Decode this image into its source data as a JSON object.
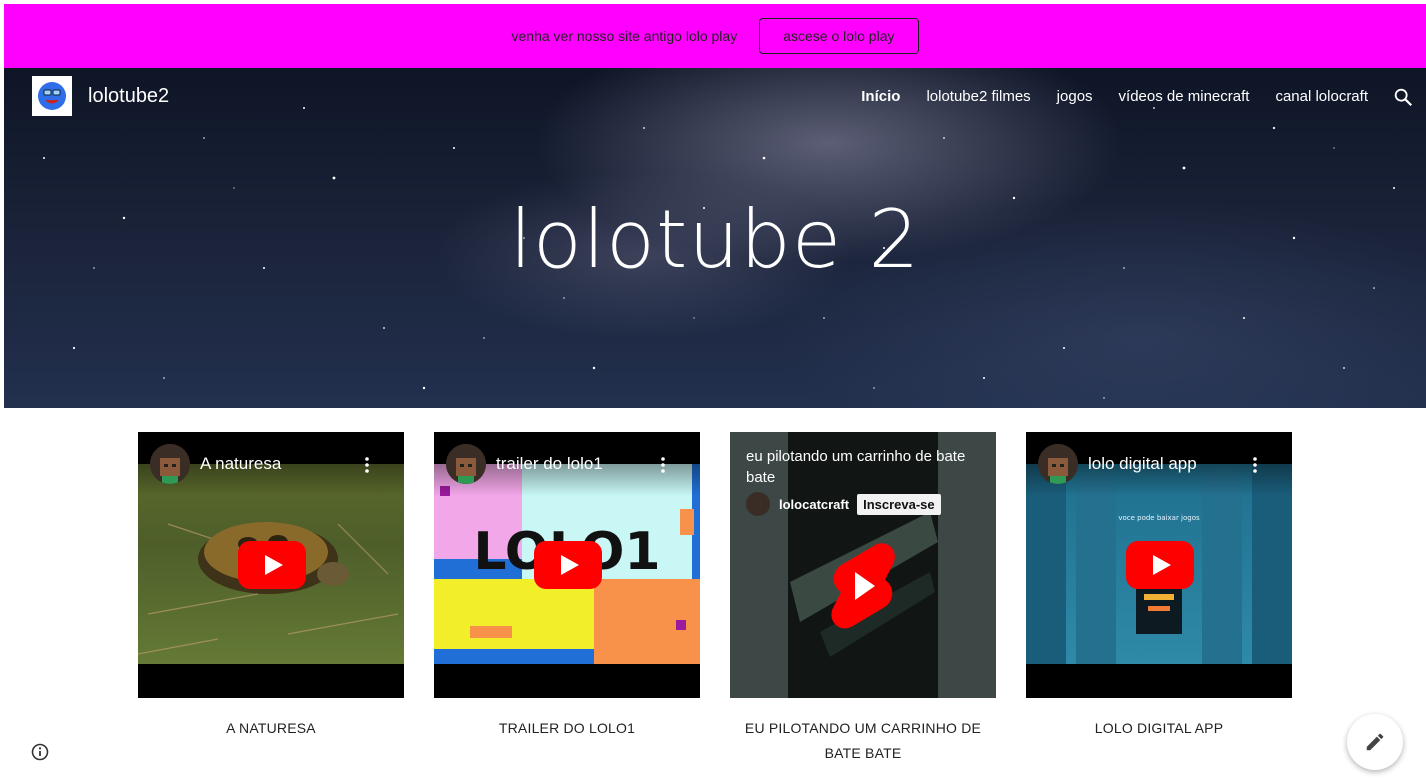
{
  "announcement": {
    "text": "venha ver nosso site antigo lolo play",
    "button_label": "ascese o lolo play",
    "background": "#ff00ff"
  },
  "header": {
    "site_name": "lolotube2",
    "logo_icon": "blue-monster-logo",
    "nav": [
      {
        "label": "Início",
        "active": true
      },
      {
        "label": "lolotube2 filmes",
        "active": false
      },
      {
        "label": "jogos",
        "active": false
      },
      {
        "label": "vídeos de minecraft",
        "active": false
      },
      {
        "label": "canal lolocraft",
        "active": false
      }
    ],
    "search_icon": "search-icon"
  },
  "hero": {
    "title": "lolotube 2",
    "background": "starry-night-sky"
  },
  "videos": [
    {
      "title": "A naturesa",
      "caption": "A NATURESA",
      "type": "video"
    },
    {
      "title": "trailer do lolo1",
      "caption": "TRAILER DO LOLO1",
      "type": "video",
      "thumb_text": "LOLO1"
    },
    {
      "title": "eu pilotando um carrinho de bate bate",
      "caption": "EU PILOTANDO UM CARRINHO  DE BATE  BATE",
      "type": "short",
      "channel": "lolocatcraft",
      "subscribe_label": "Inscreva-se"
    },
    {
      "title": "lolo digital app",
      "caption": "LOLO DIGITAL APP",
      "type": "video",
      "thumb_text": "voce pode baixar jogos"
    }
  ],
  "colors": {
    "youtube_red": "#ff0000",
    "text_dark": "#222222"
  }
}
